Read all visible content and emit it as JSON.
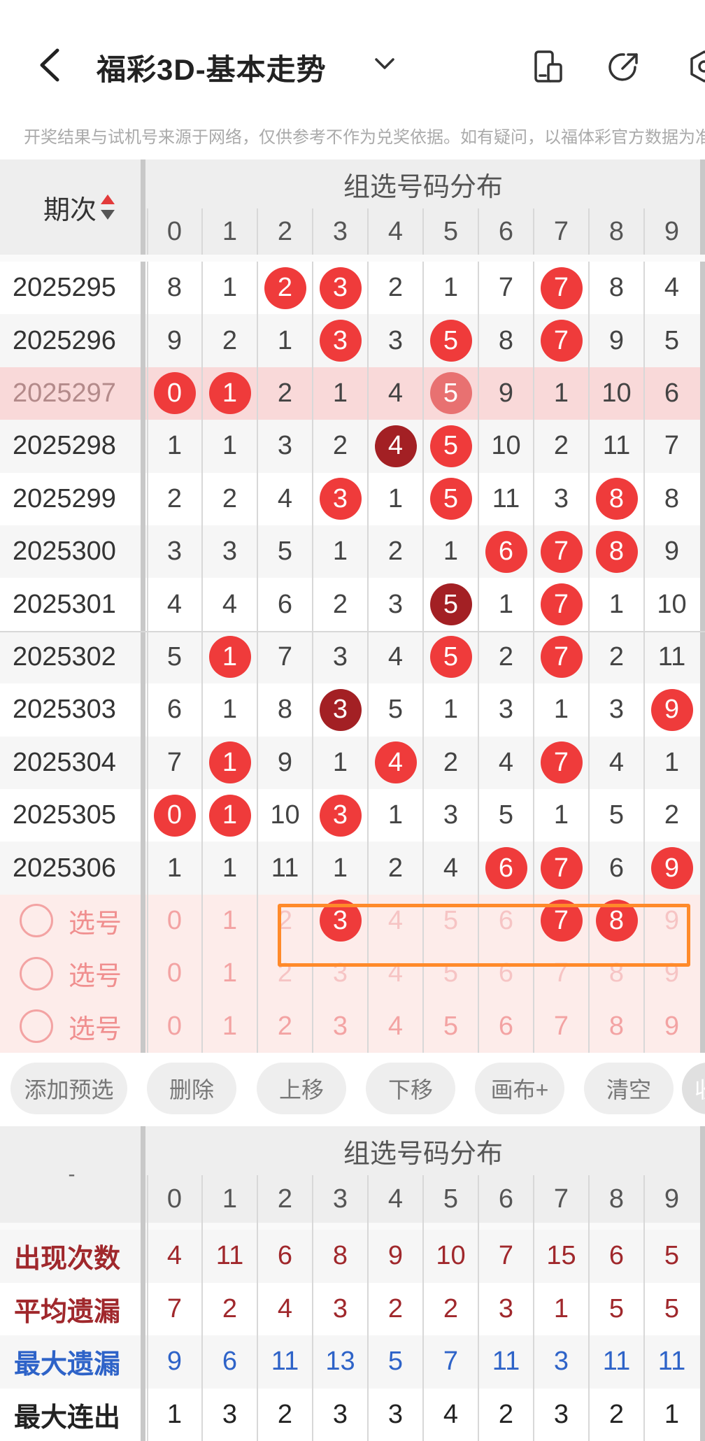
{
  "header": {
    "title": "福彩3D-基本走势",
    "back_icon": "chevron-left-icon",
    "dropdown_icon": "chevron-down-icon",
    "icons": [
      "device-icon",
      "share-icon",
      "settings-icon"
    ]
  },
  "notice": "开奖结果与试机号来源于网络，仅供参考不作为兑奖依据。如有疑问，以福体彩官方数据为准",
  "trend": {
    "period_header": "期次",
    "group_header": "组选号码分布",
    "columns": [
      "0",
      "1",
      "2",
      "3",
      "4",
      "5",
      "6",
      "7",
      "8",
      "9"
    ],
    "highlight_row": "2025297",
    "rows": [
      {
        "period": "2025295",
        "cells": [
          "8",
          "1",
          "2",
          "3",
          "2",
          "1",
          "7",
          "7",
          "8",
          "4"
        ],
        "balls": [
          2,
          3,
          7
        ],
        "dark": []
      },
      {
        "period": "2025296",
        "cells": [
          "9",
          "2",
          "1",
          "3",
          "3",
          "5",
          "8",
          "7",
          "9",
          "5"
        ],
        "balls": [
          3,
          5,
          7
        ],
        "dark": []
      },
      {
        "period": "2025297",
        "cells": [
          "0",
          "1",
          "2",
          "1",
          "4",
          "5",
          "9",
          "1",
          "10",
          "6"
        ],
        "balls": [
          0,
          1,
          5
        ],
        "dark": []
      },
      {
        "period": "2025298",
        "cells": [
          "1",
          "1",
          "3",
          "2",
          "4",
          "5",
          "10",
          "2",
          "11",
          "7"
        ],
        "balls": [
          4,
          5
        ],
        "dark": [
          4
        ]
      },
      {
        "period": "2025299",
        "cells": [
          "2",
          "2",
          "4",
          "3",
          "1",
          "5",
          "11",
          "3",
          "8",
          "8"
        ],
        "balls": [
          3,
          5,
          8
        ],
        "dark": []
      },
      {
        "period": "2025300",
        "cells": [
          "3",
          "3",
          "5",
          "1",
          "2",
          "1",
          "6",
          "7",
          "8",
          "9"
        ],
        "balls": [
          6,
          7,
          8
        ],
        "dark": []
      },
      {
        "period": "2025301",
        "cells": [
          "4",
          "4",
          "6",
          "2",
          "3",
          "5",
          "1",
          "7",
          "1",
          "10"
        ],
        "balls": [
          5,
          7
        ],
        "dark": [
          5
        ]
      },
      {
        "period": "2025302",
        "cells": [
          "5",
          "1",
          "7",
          "3",
          "4",
          "5",
          "2",
          "7",
          "2",
          "11"
        ],
        "balls": [
          1,
          5,
          7
        ],
        "dark": []
      },
      {
        "period": "2025303",
        "cells": [
          "6",
          "1",
          "8",
          "3",
          "5",
          "1",
          "3",
          "1",
          "3",
          "9"
        ],
        "balls": [
          3,
          9
        ],
        "dark": [
          3
        ]
      },
      {
        "period": "2025304",
        "cells": [
          "7",
          "1",
          "9",
          "1",
          "4",
          "2",
          "4",
          "7",
          "4",
          "1"
        ],
        "balls": [
          1,
          4,
          7
        ],
        "dark": []
      },
      {
        "period": "2025305",
        "cells": [
          "0",
          "1",
          "10",
          "3",
          "1",
          "3",
          "5",
          "1",
          "5",
          "2"
        ],
        "balls": [
          0,
          1,
          3
        ],
        "dark": []
      },
      {
        "period": "2025306",
        "cells": [
          "1",
          "1",
          "11",
          "1",
          "2",
          "4",
          "6",
          "7",
          "6",
          "9"
        ],
        "balls": [
          6,
          7,
          9
        ],
        "dark": []
      }
    ],
    "pick_rows": [
      {
        "label": "选号",
        "cells": [
          "0",
          "1",
          "2",
          "3",
          "4",
          "5",
          "6",
          "7",
          "8",
          "9"
        ],
        "selected": [
          3,
          7,
          8
        ],
        "faint": true
      },
      {
        "label": "选号",
        "cells": [
          "0",
          "1",
          "2",
          "3",
          "4",
          "5",
          "6",
          "7",
          "8",
          "9"
        ],
        "selected": [],
        "faint": true
      },
      {
        "label": "选号",
        "cells": [
          "0",
          "1",
          "2",
          "3",
          "4",
          "5",
          "6",
          "7",
          "8",
          "9"
        ],
        "selected": [],
        "faint": false
      }
    ]
  },
  "toolbar": {
    "buttons": [
      "添加预选",
      "删除",
      "上移",
      "下移",
      "画布+",
      "清空"
    ],
    "collapse_label": "收"
  },
  "stats": {
    "corner": "-",
    "group_header": "组选号码分布",
    "columns": [
      "0",
      "1",
      "2",
      "3",
      "4",
      "5",
      "6",
      "7",
      "8",
      "9"
    ],
    "rows": [
      {
        "label": "出现次数",
        "color": "#a0282c",
        "values": [
          "4",
          "11",
          "6",
          "8",
          "9",
          "10",
          "7",
          "15",
          "6",
          "5"
        ]
      },
      {
        "label": "平均遗漏",
        "color": "#a0282c",
        "values": [
          "7",
          "2",
          "4",
          "3",
          "2",
          "2",
          "3",
          "1",
          "5",
          "5"
        ]
      },
      {
        "label": "最大遗漏",
        "color": "#2e63c8",
        "values": [
          "9",
          "6",
          "11",
          "13",
          "5",
          "7",
          "11",
          "3",
          "11",
          "11"
        ]
      },
      {
        "label": "最大连出",
        "color": "#222222",
        "values": [
          "1",
          "3",
          "2",
          "3",
          "3",
          "4",
          "2",
          "3",
          "2",
          "1"
        ]
      }
    ]
  },
  "colors": {
    "ball": "#ef3b3b",
    "ball_dark": "#a32024",
    "selection_box": "#ff8a2a"
  }
}
